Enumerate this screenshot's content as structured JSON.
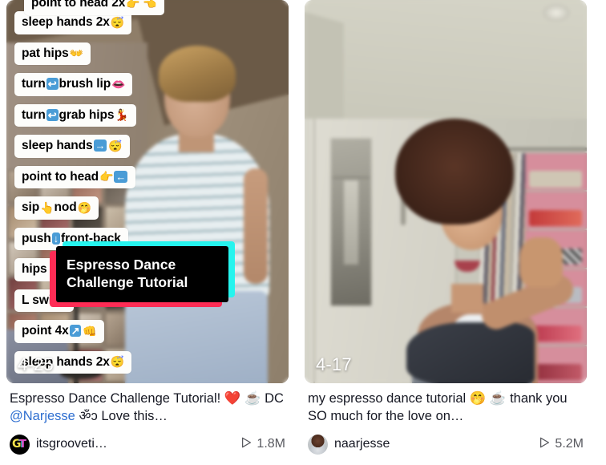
{
  "cards": [
    {
      "id": "card-left",
      "date_badge": "4-25",
      "title_card": {
        "line1": "Espresso Dance",
        "line2": "Challenge Tutorial",
        "shadow_cyan": "#25f4ee",
        "shadow_pink": "#fe2c55",
        "background": "#000000",
        "text_color": "#ffffff"
      },
      "stickers": [
        {
          "text": "point to head 2x",
          "emoji": "👉 👈"
        },
        {
          "text": "sleep hands 2x",
          "emoji": "😴"
        },
        {
          "text": "pat hips",
          "emoji": "👐"
        },
        {
          "text": "turn",
          "box": "↩",
          "text2": "brush lip",
          "emoji": "👄"
        },
        {
          "text": "turn",
          "box": "↩",
          "text2": "grab hips",
          "emoji": "💃"
        },
        {
          "text": "sleep hands",
          "box": "→",
          "emoji": "😴"
        },
        {
          "text": "point to head",
          "emoji": "👉",
          "box2": "←"
        },
        {
          "text": "sip",
          "emoji": "👆",
          "text2": "nod",
          "emoji2": "🤭"
        },
        {
          "text": "push",
          "box": "↓",
          "text2": "front-back"
        },
        {
          "text": "hips 2x"
        },
        {
          "text": "L swipe"
        },
        {
          "text": "point 4x",
          "box": "↗",
          "emoji": "👊"
        },
        {
          "text": "sleep hands 2x",
          "emoji": "😴"
        }
      ],
      "caption_line1": "Espresso Dance Challenge Tutorial!",
      "caption_emoji1": "❤️",
      "caption_emoji2": "☕",
      "caption_dc_label": "DC",
      "caption_mention": "@Narjesse",
      "caption_tail": "ॐɔ Love this…",
      "handle": "itsgrooveti…",
      "plays": "1.8M",
      "avatar_type": "gt-logo-avatar"
    },
    {
      "id": "card-right",
      "date_badge": "4-17",
      "caption_line1": "my espresso dance tutorial",
      "caption_emoji1": "🤭",
      "caption_emoji2": "☕",
      "caption_line2": "thank you SO much for the love on…",
      "handle": "naarjesse",
      "plays": "5.2M",
      "avatar_type": "photo-avatar"
    }
  ],
  "icons": {
    "play": "play-count-icon"
  }
}
